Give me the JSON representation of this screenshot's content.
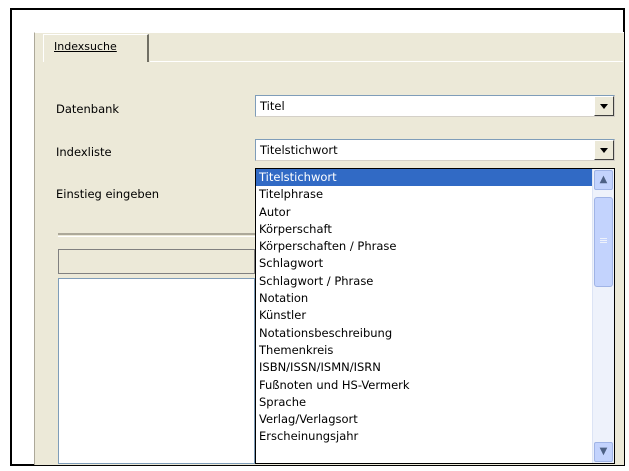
{
  "tab": {
    "label": "Indexsuche"
  },
  "form": {
    "datenbank": {
      "label": "Datenbank",
      "value": "Titel"
    },
    "indexliste": {
      "label": "Indexliste",
      "value": "Titelstichwort"
    },
    "einstieg": {
      "label": "Einstieg eingeben"
    }
  },
  "dropdown": {
    "selected_index": 0,
    "options": [
      "Titelstichwort",
      "Titelphrase",
      "Autor",
      "Körperschaft",
      "Körperschaften / Phrase",
      "Schlagwort",
      "Schlagwort / Phrase",
      "Notation",
      "Künstler",
      "Notationsbeschreibung",
      "Themenkreis",
      "ISBN/ISSN/ISMN/ISRN",
      "Fußnoten und HS-Vermerk",
      "Sprache",
      "Verlag/Verlagsort",
      "Erscheinungsjahr"
    ]
  },
  "colors": {
    "selection": "#316ac5",
    "panel": "#ece9d8",
    "scrollbar": "#c3d3fd"
  }
}
